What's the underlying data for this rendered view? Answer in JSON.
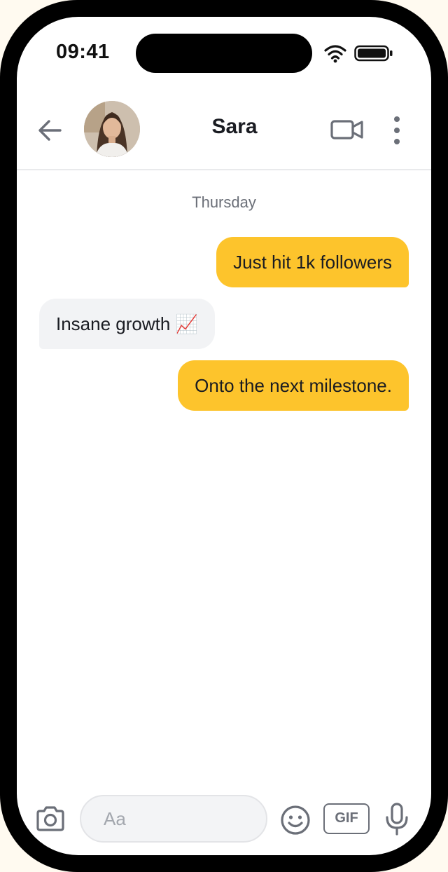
{
  "status_bar": {
    "time": "09:41"
  },
  "header": {
    "contact_name": "Sara",
    "icons": [
      "back-arrow-icon",
      "video-camera-icon",
      "more-vertical-icon"
    ]
  },
  "conversation": {
    "day_label": "Thursday",
    "messages": [
      {
        "direction": "outgoing",
        "text": "Just hit 1k followers"
      },
      {
        "direction": "incoming",
        "text": "Insane growth 📈"
      },
      {
        "direction": "outgoing",
        "text": "Onto the next milestone."
      }
    ]
  },
  "composer": {
    "placeholder": "Aa",
    "value": "",
    "gif_label": "GIF",
    "icons": [
      "camera-icon",
      "emoji-icon",
      "microphone-icon"
    ]
  },
  "colors": {
    "outgoing_bubble": "#fdc42c",
    "incoming_bubble": "#f2f3f5",
    "icon_gray": "#6b6f78",
    "text_dark": "#1a1c22"
  }
}
